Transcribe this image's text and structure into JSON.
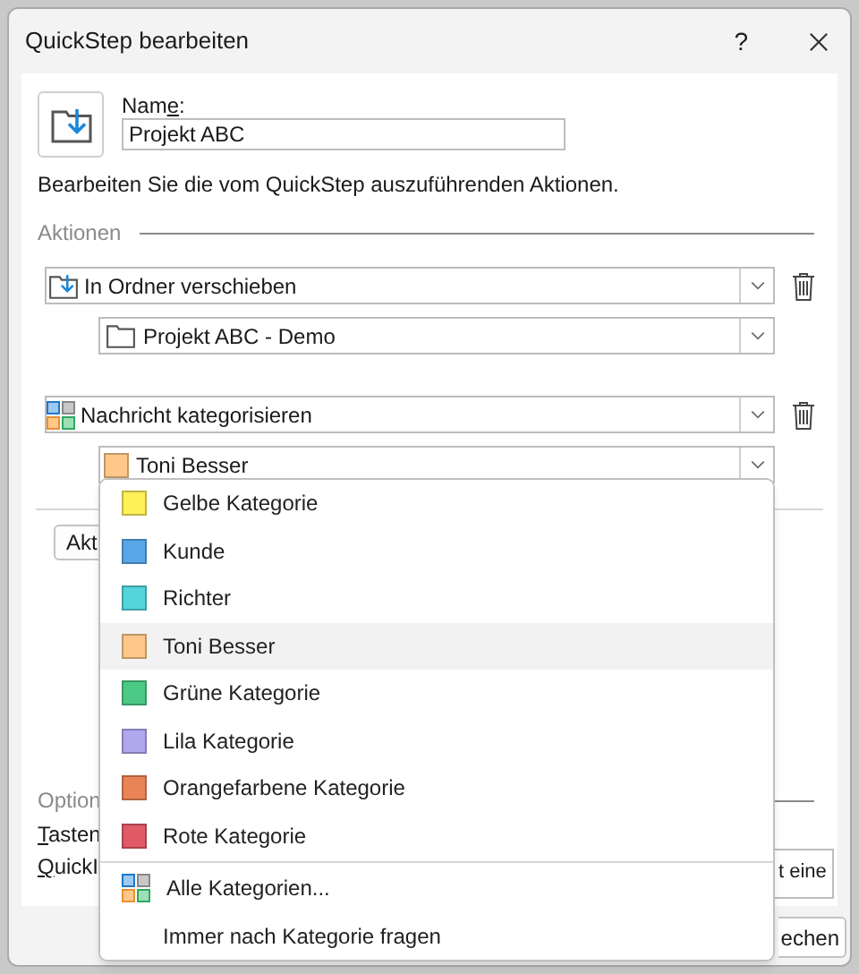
{
  "window": {
    "title": "QuickStep bearbeiten",
    "help": "?"
  },
  "name_field": {
    "label": {
      "before": "Nam",
      "key": "e",
      "after": ":"
    },
    "value": "Projekt ABC"
  },
  "description": "Bearbeiten Sie die vom QuickStep auszuführenden Aktionen.",
  "actions_heading": "Aktionen",
  "actions": [
    {
      "kind": "move",
      "value": "In Ordner verschieben",
      "option": {
        "kind": "folder",
        "value": "Projekt ABC - Demo"
      }
    },
    {
      "kind": "categorize",
      "value": "Nachricht kategorisieren",
      "option": {
        "kind": "category",
        "value": "Toni Besser",
        "color": "#ffc88a"
      }
    }
  ],
  "add_action_button": "Akt",
  "options_heading": "Option",
  "shortcut_label": {
    "key": "T",
    "after": "asten"
  },
  "tooltip_label": {
    "key": "Q",
    "after": "uickI"
  },
  "tooltip_field_value": "t eine",
  "footer_button": "echen",
  "category_menu": [
    {
      "kind": "category",
      "label": "Gelbe Kategorie",
      "color": "#fff05a",
      "selected": false
    },
    {
      "kind": "category",
      "label": "Kunde",
      "color": "#5aa7e8",
      "selected": false
    },
    {
      "kind": "category",
      "label": "Richter",
      "color": "#55d4dc",
      "selected": false
    },
    {
      "kind": "category",
      "label": "Toni Besser",
      "color": "#ffc88a",
      "selected": true
    },
    {
      "kind": "category",
      "label": "Grüne Kategorie",
      "color": "#4cca85",
      "selected": false
    },
    {
      "kind": "category",
      "label": "Lila Kategorie",
      "color": "#b0a8ee",
      "selected": false
    },
    {
      "kind": "category",
      "label": "Orangefarbene Kategorie",
      "color": "#ea8457",
      "selected": false
    },
    {
      "kind": "category",
      "label": "Rote Kategorie",
      "color": "#e05a66",
      "selected": false
    },
    {
      "kind": "all",
      "label": "Alle Kategorien...",
      "selected": false
    },
    {
      "kind": "ask",
      "label": "Immer nach Kategorie fragen",
      "selected": false
    }
  ]
}
